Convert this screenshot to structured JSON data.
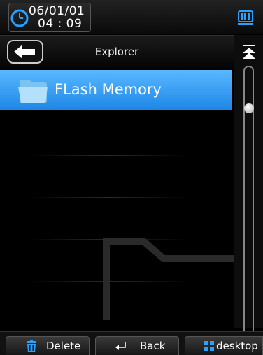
{
  "status": {
    "date": "06/01/01",
    "time": "04 : 09"
  },
  "nav": {
    "title": "Explorer"
  },
  "list": {
    "items": [
      {
        "label": "FLash Memory",
        "selected": true
      }
    ]
  },
  "bottom": {
    "delete_label": "Delete",
    "back_label": "Back",
    "desktop_label": "desktop"
  },
  "colors": {
    "selection": "#1d86e6",
    "accent_blue": "#2aa0ff"
  }
}
